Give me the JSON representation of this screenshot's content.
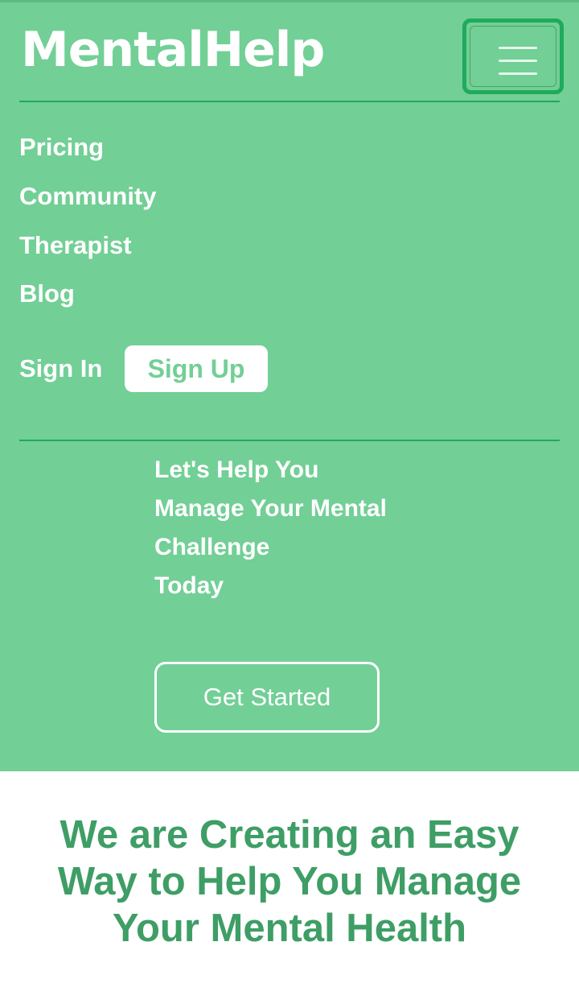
{
  "header": {
    "logo": "MentalHelp",
    "menu_icon": "hamburger-menu-icon"
  },
  "nav": {
    "items": [
      {
        "label": "Pricing"
      },
      {
        "label": "Community"
      },
      {
        "label": "Therapist"
      },
      {
        "label": "Blog"
      }
    ],
    "sign_in": "Sign In",
    "sign_up": "Sign Up"
  },
  "hero": {
    "headline_lines": [
      "Let's Help You",
      "Manage Your Mental",
      "Challenge",
      "Today"
    ],
    "cta_label": "Get Started"
  },
  "section": {
    "tagline_lines": [
      "We are Creating an Easy",
      "Way to Help You Manage",
      "Your Mental Health"
    ]
  },
  "colors": {
    "brand_green": "#72cf96",
    "accent_green": "#1faa5c",
    "heading_green": "#3e9e65",
    "white": "#ffffff"
  }
}
